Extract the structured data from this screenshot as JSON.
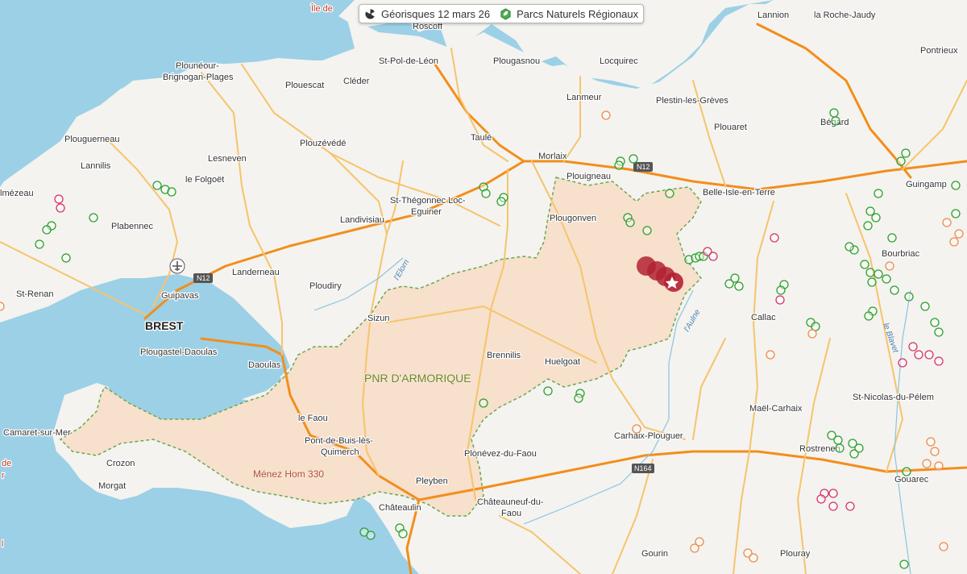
{
  "legend": {
    "items": [
      {
        "label": "Géorisques 12 mars 26",
        "icon": "radiation-trefoil-icon"
      },
      {
        "label": "Parcs Naturels Régionaux",
        "icon": "park-leaf-icon"
      }
    ]
  },
  "map": {
    "colors": {
      "sea": "#9cd0e6",
      "land": "#f4f3ef",
      "park_fill": "#f7e0cc",
      "park_border": "#6aa84f",
      "motorway": "#f28e1c",
      "main_road": "#f6c46b",
      "marker_green": "#2ca02c",
      "marker_orange": "#f08a4b",
      "marker_pink": "#d6336c",
      "marker_red": "#b22232"
    },
    "labels": {
      "ile": "Île de",
      "roscoff": "Roscoff",
      "lannion": "Lannion",
      "roche_jaudy": "la Roche-Jaudy",
      "pontrieux": "Pontrieux",
      "plouneour": "Plounéour-",
      "brignogan": "Brignogan-Plages",
      "stpol": "St-Pol-de-Léon",
      "plougasnou": "Plougasnou",
      "locquirec": "Locquirec",
      "plouescat": "Plouescat",
      "cleder": "Cléder",
      "lanmeur": "Lanmeur",
      "plestin": "Plestin-les-Grèves",
      "begard": "Bégard",
      "plouguerneau": "Plouguerneau",
      "taule": "Taulé",
      "plouaret": "Plouaret",
      "plouzevede": "Plouzévédé",
      "morlaix": "Morlaix",
      "lannilis": "Lannilis",
      "lesneven": "Lesneven",
      "folgoet": "le Folgoët",
      "plouigneau": "Plouigneau",
      "n12a": "N12",
      "belle_isle": "Belle-Isle-en-Terre",
      "guingamp": "Guingamp",
      "mezeau": "lmézeau",
      "st_thegonnec": "St-Thégonnec Loc-",
      "eguiner": "Eguiner",
      "plougonven": "Plougonven",
      "plabennec": "Plabennec",
      "landivisiau": "Landivisiau",
      "bourbriac": "Bourbriac",
      "landerneau": "Landerneau",
      "n12b": "N12",
      "ploudiry": "Ploudiry",
      "elorn": "l'Elorn",
      "st_renan": "St-Renan",
      "guipavas": "Guipavas",
      "callac": "Callac",
      "aulne": "l'Aulne",
      "brest": "BREST",
      "sizun": "Sizun",
      "blavet": "le Blavet",
      "plougastel": "Plougastel-Daoulas",
      "brennilis": "Brennilis",
      "huelgoat": "Huelgoat",
      "daoulas": "Daoulas",
      "pnr": "PNR D'ARMORIQUE",
      "st_nicolas": "St-Nicolas-du-Pélem",
      "le_faou": "le Faou",
      "mael_carhaix": "Maël-Carhaix",
      "camaret": "Camaret-sur-Mer",
      "carhaix": "Carhaix-Plouguer",
      "pont_de_buis": "Pont-de-Buis-lès-",
      "quimerch": "Quimerch",
      "plonevez": "Plonévez-du-Faou",
      "de": "de",
      "crozon": "Crozon",
      "n164": "N164",
      "rostrenen": "Rostrenen",
      "menez_hom": "Ménez Hom 330",
      "r_edge": "r",
      "morgat": "Morgat",
      "pleyben": "Pleyben",
      "gouarec": "Gouarec",
      "chateaulin": "Châteaulin",
      "chateauneuf": "Châteauneuf-du-",
      "faou": "Faou",
      "l_edge": "l",
      "gourin": "Gourin",
      "plouray": "Plouray"
    }
  }
}
